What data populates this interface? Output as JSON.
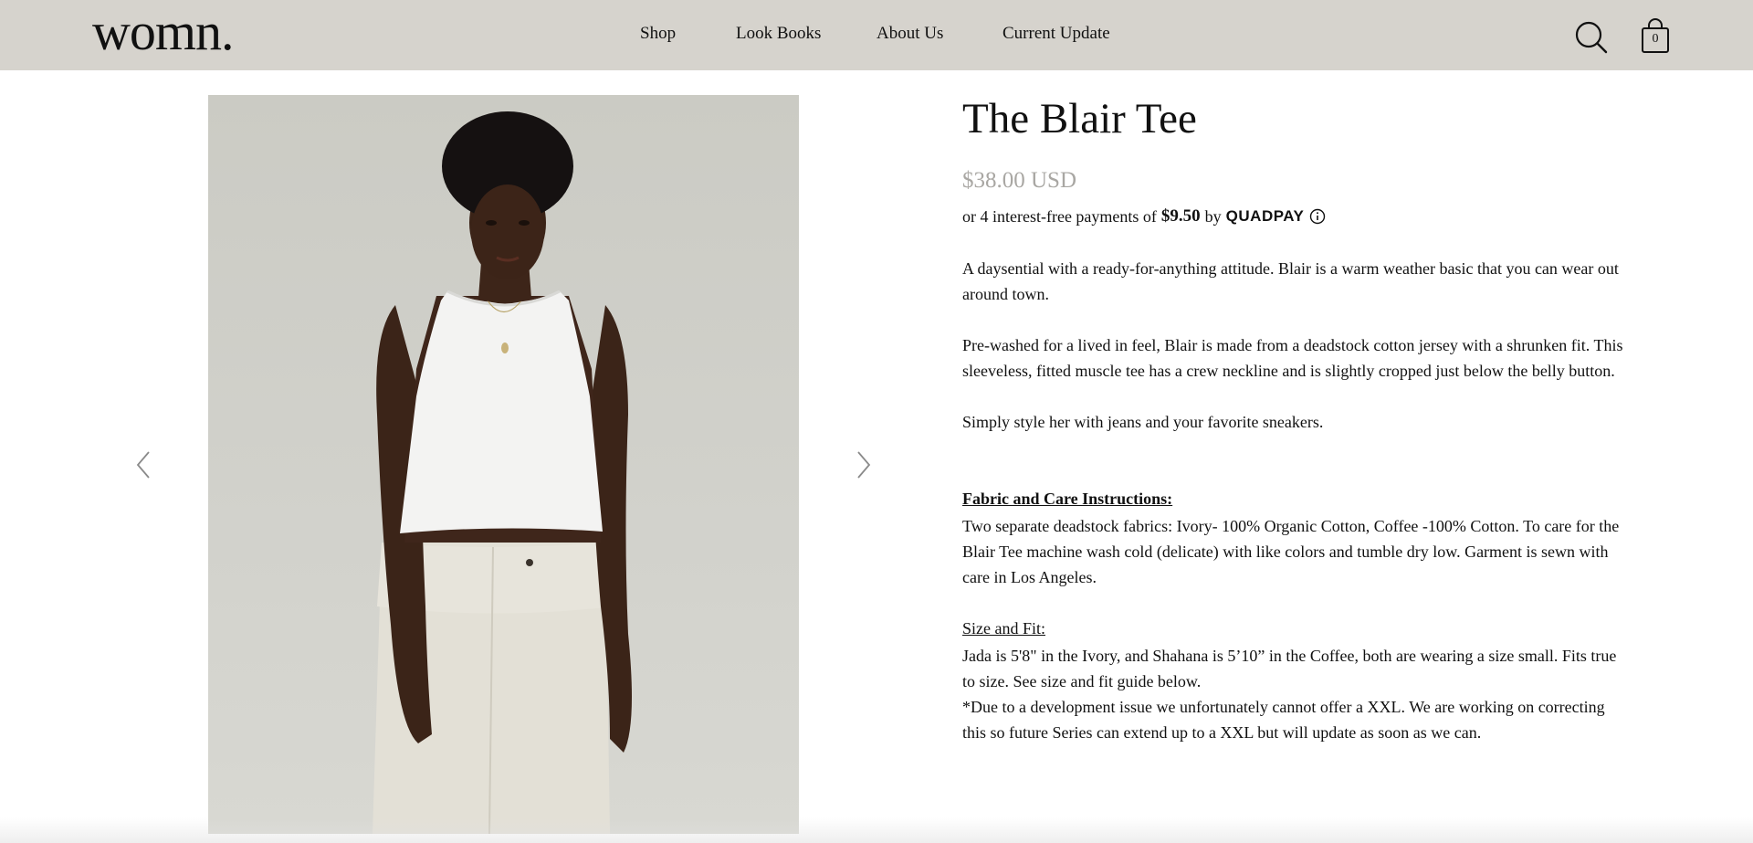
{
  "header": {
    "logo": "womn.",
    "nav": [
      "Shop",
      "Look Books",
      "About Us",
      "Current Update"
    ],
    "search_icon": "search-icon",
    "cart_icon": "shopping-bag-icon",
    "cart_count": "0",
    "background": "#d6d3cd"
  },
  "gallery": {
    "prev_icon": "chevron-left-icon",
    "next_icon": "chevron-right-icon",
    "image_description_icon": "product-photo"
  },
  "product": {
    "title": "The Blair Tee",
    "price": "$38.00 USD",
    "price_color": "#a9a7a3",
    "installment_prefix": "or 4 interest-free payments of",
    "installment_amount": "$9.50",
    "installment_by": "by",
    "installment_provider": "QUADPAY",
    "description_1": "A daysential with a ready-for-anything attitude. Blair is a warm weather basic that you can wear out around town.",
    "description_2": "Pre-washed for a lived in feel, Blair is made from a deadstock cotton jersey with a shrunken fit. This sleeveless, fitted muscle tee has a crew neckline and is slightly cropped just below the belly button.",
    "description_3": "Simply style her with jeans and your favorite sneakers.",
    "fabric_heading": "Fabric and Care Instructions:",
    "fabric_text": "Two separate deadstock fabrics: Ivory- 100% Organic Cotton, Coffee -100% Cotton. To care for the Blair Tee machine wash cold (delicate) with like colors and tumble dry low. Garment is sewn with care in Los Angeles.",
    "size_heading": "Size and Fit:",
    "size_text_1": "Jada is 5'8\" in the Ivory, and Shahana is 5’10” in the Coffee, both are wearing a size small. Fits true to size. See size and fit guide below.",
    "size_text_2": "*Due to a development issue we unfortunately cannot offer a XXL. We are working on correcting this so future Series can extend up to a XXL but will update as soon as we can."
  }
}
